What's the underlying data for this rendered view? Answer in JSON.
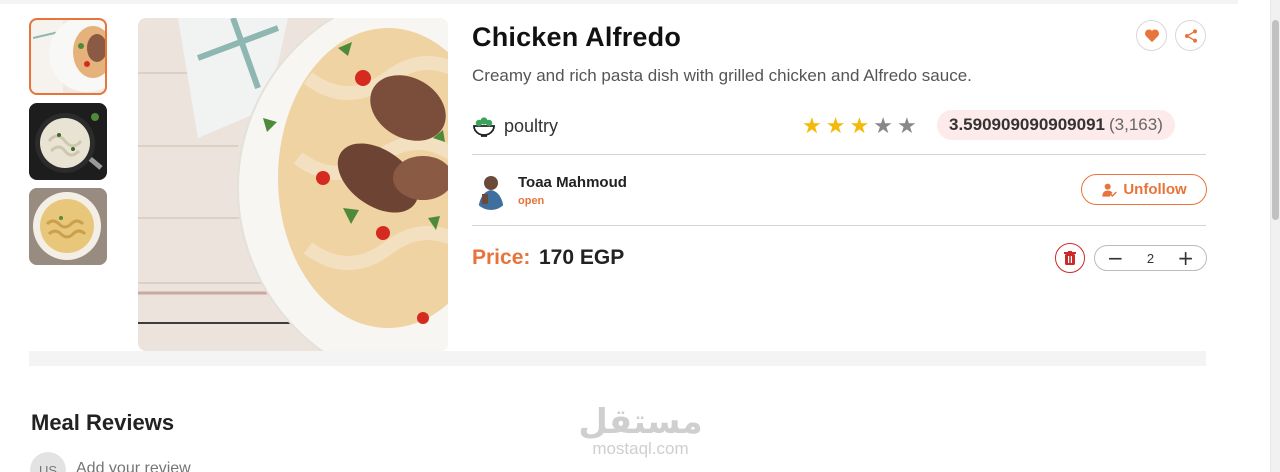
{
  "meal": {
    "title": "Chicken Alfredo",
    "description": "Creamy and rich pasta dish with grilled chicken and Alfredo sauce.",
    "category": "poultry",
    "rating_value": "3.590909090909091",
    "rating_count": "(3,163)",
    "stars": 3,
    "stars_max": 5,
    "price_label": "Price:",
    "price_value": "170 EGP",
    "quantity": "2"
  },
  "author": {
    "name": "Toaa Mahmoud",
    "status": "open",
    "follow_button_label": "Unfollow"
  },
  "thumbnails": [
    {
      "name": "plate-chicken-thumb",
      "active": true
    },
    {
      "name": "pasta-pan-thumb",
      "active": false
    },
    {
      "name": "pasta-bowl-thumb",
      "active": false
    }
  ],
  "reviews": {
    "title": "Meal Reviews",
    "user_initials": "US",
    "input_placeholder": "Add your review"
  },
  "watermark": {
    "arabic": "مستقل",
    "latin": "mostaql.com"
  },
  "icons": {
    "favorite": "heart-icon",
    "share": "share-icon",
    "category": "salad-bowl-icon",
    "unfollow": "user-check-icon",
    "delete": "trash-icon",
    "decrement": "minus-icon",
    "increment": "plus-icon",
    "star": "star-icon"
  },
  "colors": {
    "accent": "#e8733b",
    "star_on": "#f5b90a",
    "star_off": "#888888",
    "rating_pill_bg": "#fdeaea",
    "delete_red": "#cc2a2a"
  }
}
